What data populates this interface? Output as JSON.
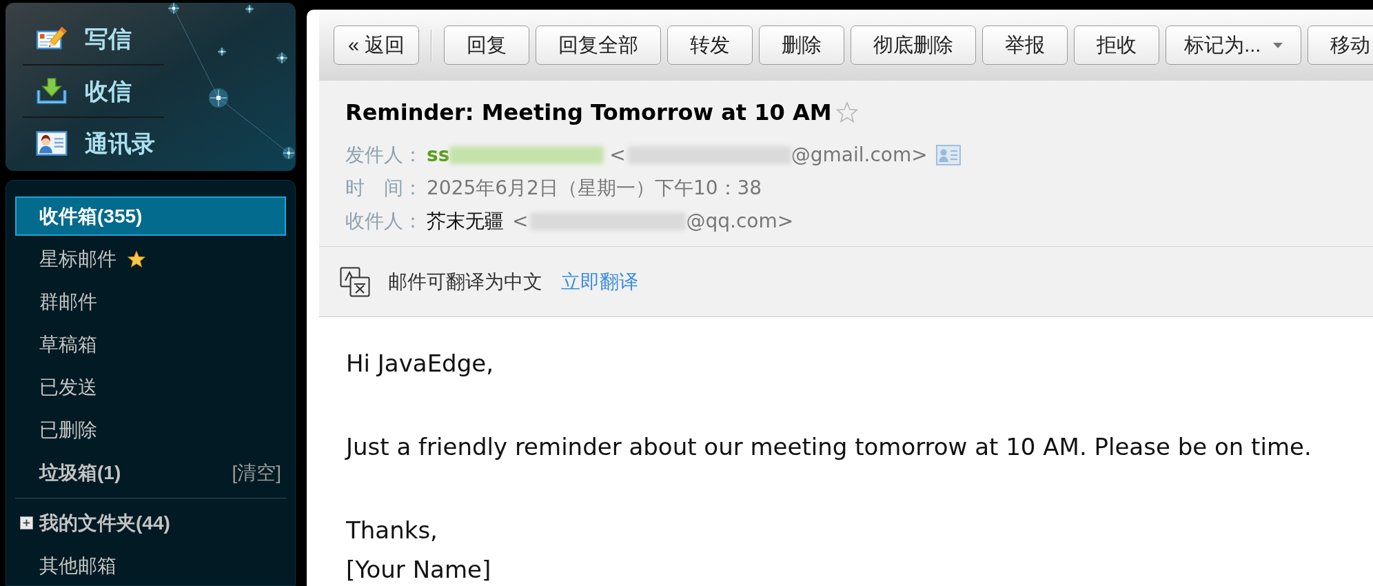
{
  "sidebar": {
    "actions": [
      {
        "kind": "compose",
        "label": "写信"
      },
      {
        "kind": "receive",
        "label": "收信"
      },
      {
        "kind": "contacts",
        "label": "通讯录"
      }
    ],
    "folders": [
      {
        "kind": "folder",
        "label": "收件箱(355)",
        "selected": true,
        "unread": true
      },
      {
        "kind": "starred",
        "label": "星标邮件",
        "selected": false,
        "unread": false
      },
      {
        "kind": "folder",
        "label": "群邮件",
        "selected": false,
        "unread": false
      },
      {
        "kind": "folder",
        "label": "草稿箱",
        "selected": false,
        "unread": false
      },
      {
        "kind": "folder",
        "label": "已发送",
        "selected": false,
        "unread": false
      },
      {
        "kind": "folder",
        "label": "已删除",
        "selected": false,
        "unread": false
      },
      {
        "kind": "folder",
        "label": "垃圾箱(1)",
        "selected": false,
        "unread": true,
        "action": "[清空]"
      }
    ],
    "my_folders": {
      "label": "我的文件夹(44)",
      "unread": true,
      "expanded": false
    },
    "other_mailboxes": {
      "label": "其他邮箱",
      "unread": false
    }
  },
  "toolbar": {
    "buttons": [
      {
        "kind": "back",
        "label": "« 返回"
      },
      {
        "kind": "plain",
        "label": "回复"
      },
      {
        "kind": "plain",
        "label": "回复全部"
      },
      {
        "kind": "plain",
        "label": "转发"
      },
      {
        "kind": "plain",
        "label": "删除"
      },
      {
        "kind": "plain",
        "label": "彻底删除"
      },
      {
        "kind": "plain",
        "label": "举报"
      },
      {
        "kind": "plain",
        "label": "拒收"
      },
      {
        "kind": "dropdown",
        "label": "标记为..."
      },
      {
        "kind": "plain",
        "label": "移动"
      }
    ]
  },
  "message": {
    "subject": "Reminder: Meeting Tomorrow at 10 AM",
    "starred": false,
    "from": {
      "label": "发件人：",
      "name": "ss",
      "redacted": true,
      "address_open": "<",
      "address_end": "@gmail.com>"
    },
    "time": {
      "label": "时　间：",
      "value": "2025年6月2日（星期一）下午10：38"
    },
    "to": {
      "label": "收件人：",
      "name": "芥末无疆",
      "redacted": true,
      "address_open": "<",
      "address_end": "@qq.com>"
    },
    "translate": {
      "notice": "邮件可翻译为中文",
      "link": "立即翻译"
    },
    "body": [
      [
        "Hi JavaEdge,"
      ],
      [
        "Just a friendly reminder about our meeting tomorrow at 10 AM. Please be on time."
      ],
      [
        "Thanks,",
        "[Your Name]"
      ]
    ]
  }
}
